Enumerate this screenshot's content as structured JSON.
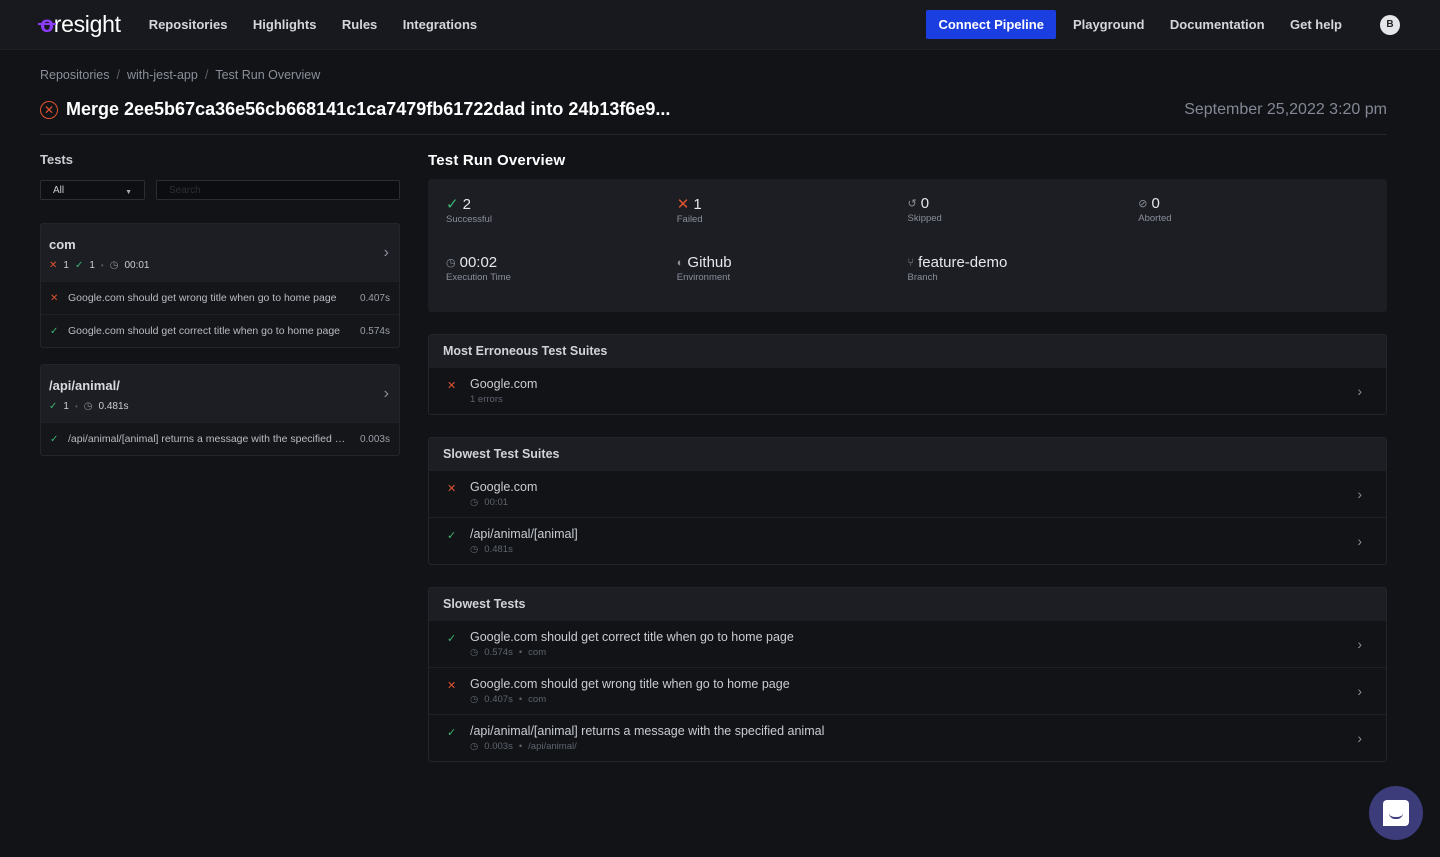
{
  "topbar": {
    "logo": "foresight",
    "nav": [
      "Repositories",
      "Highlights",
      "Rules",
      "Integrations"
    ],
    "connect_button": "Connect Pipeline",
    "right_nav": [
      "Playground",
      "Documentation",
      "Get help"
    ],
    "avatar": "B"
  },
  "breadcrumb": [
    "Repositories",
    "with-jest-app",
    "Test Run Overview"
  ],
  "header": {
    "title": "Merge 2ee5b67ca36e56cb668141c1ca7479fb61722dad into 24b13f6e9...",
    "date": "September 25,2022 3:20 pm",
    "status": "failed"
  },
  "tests_panel": {
    "title": "Tests",
    "filter_value": "All",
    "search_placeholder": "Search",
    "suites": [
      {
        "name": "com",
        "failed": "1",
        "passed": "1",
        "duration": "00:01",
        "tests": [
          {
            "status": "failed",
            "name": "Google.com should get wrong title when go to home page",
            "time": "0.407s"
          },
          {
            "status": "passed",
            "name": "Google.com should get correct title when go to home page",
            "time": "0.574s"
          }
        ]
      },
      {
        "name": "/api/animal/",
        "passed": "1",
        "duration": "0.481s",
        "tests": [
          {
            "status": "passed",
            "name": "/api/animal/[animal] returns a message with the specified animal",
            "time": "0.003s"
          }
        ]
      }
    ]
  },
  "overview": {
    "title": "Test Run Overview",
    "stats": [
      {
        "value": "2",
        "label": "Successful",
        "icon": "check-icon"
      },
      {
        "value": "1",
        "label": "Failed",
        "icon": "x-icon"
      },
      {
        "value": "0",
        "label": "Skipped",
        "icon": "skip-icon"
      },
      {
        "value": "0",
        "label": "Aborted",
        "icon": "abort-icon"
      },
      {
        "value": "00:02",
        "label": "Execution Time",
        "icon": "clock-icon"
      },
      {
        "value": "Github",
        "label": "Environment",
        "icon": "github-icon"
      },
      {
        "value": "feature-demo",
        "label": "Branch",
        "icon": "branch-icon"
      }
    ]
  },
  "erroneous": {
    "title": "Most Erroneous Test Suites",
    "rows": [
      {
        "status": "failed",
        "name": "Google.com",
        "sub": "1 errors"
      }
    ]
  },
  "slowest_suites": {
    "title": "Slowest Test Suites",
    "rows": [
      {
        "status": "failed",
        "name": "Google.com",
        "time": "00:01"
      },
      {
        "status": "passed",
        "name": "/api/animal/[animal]",
        "time": "0.481s"
      }
    ]
  },
  "slowest_tests": {
    "title": "Slowest Tests",
    "rows": [
      {
        "status": "passed",
        "name": "Google.com should get correct title when go to home page",
        "time": "0.574s",
        "suite": "com"
      },
      {
        "status": "failed",
        "name": "Google.com should get wrong title when go to home page",
        "time": "0.407s",
        "suite": "com"
      },
      {
        "status": "passed",
        "name": "/api/animal/[animal] returns a message with the specified animal",
        "time": "0.003s",
        "suite": "/api/animal/"
      }
    ]
  },
  "colors": {
    "accent": "#1b3ee0",
    "failed": "#e0532f",
    "passed": "#3cb371",
    "brand": "#8b3cf7"
  }
}
